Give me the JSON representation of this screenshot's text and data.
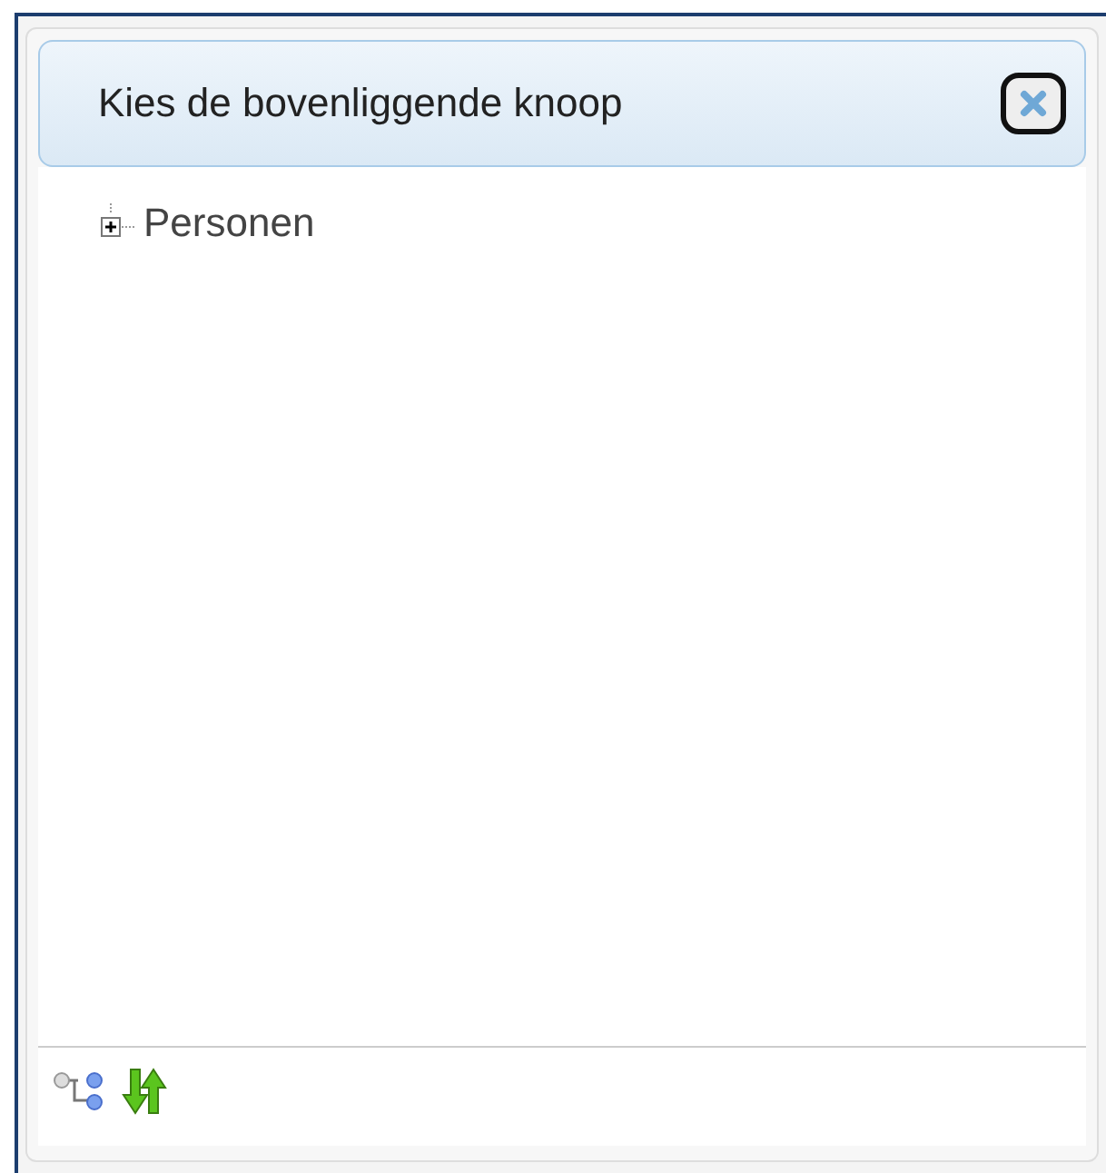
{
  "dialog": {
    "title": "Kies de bovenliggende knoop"
  },
  "tree": [
    {
      "label": "Personen",
      "expanded": false
    }
  ]
}
